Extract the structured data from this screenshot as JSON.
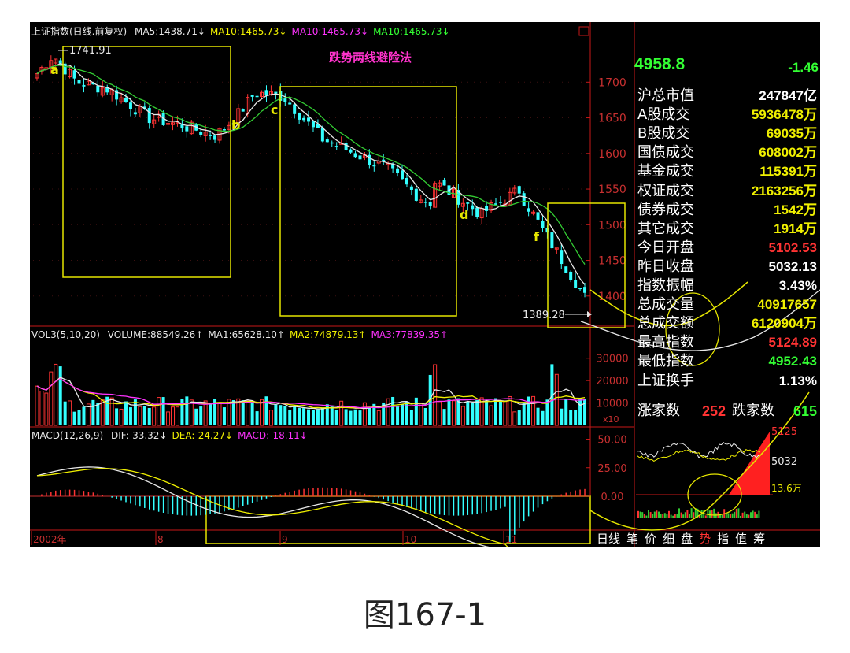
{
  "header": {
    "price_title": "上证指数(日线.前复权)",
    "price_mas": [
      {
        "text": "MA5:1438.71",
        "color": "#e8e8e8"
      },
      {
        "text": "MA10:1465.73",
        "color": "#f0f000"
      },
      {
        "text": "MA10:1465.73",
        "color": "#ff33ff"
      },
      {
        "text": "MA10:1465.73",
        "color": "#33ff33"
      }
    ],
    "vol_title": "VOL3(5,10,20)",
    "vol_items": [
      {
        "text": "VOLUME:88549.26",
        "color": "#e8e8e8"
      },
      {
        "text": "MA1:65628.10",
        "color": "#e8e8e8"
      },
      {
        "text": "MA2:74879.13",
        "color": "#f0f000"
      },
      {
        "text": "MA3:77839.35",
        "color": "#ff33ff"
      }
    ],
    "macd_title": "MACD(12,26,9)",
    "macd_items": [
      {
        "text": "DIF:-33.32",
        "color": "#e8e8e8"
      },
      {
        "text": "DEA:-24.27",
        "color": "#f0f000"
      },
      {
        "text": "MACD:-18.11",
        "color": "#ff33ff"
      }
    ]
  },
  "annotations": {
    "chart_title": "跌势两线避险法",
    "high_label": "1741.91",
    "low_label": "1389.28",
    "points": [
      "a",
      "b",
      "c",
      "d",
      "f"
    ]
  },
  "side": {
    "top_value": "4958.8",
    "top_value_right": "-1.46",
    "rows": [
      {
        "label": "沪总市值",
        "value": "247847亿",
        "color": "wht"
      },
      {
        "label": "A股成交",
        "value": "5936478万",
        "color": "yel"
      },
      {
        "label": "B股成交",
        "value": "69035万",
        "color": "yel"
      },
      {
        "label": "国债成交",
        "value": "608002万",
        "color": "yel"
      },
      {
        "label": "基金成交",
        "value": "115391万",
        "color": "yel"
      },
      {
        "label": "权证成交",
        "value": "2163256万",
        "color": "yel"
      },
      {
        "label": "债券成交",
        "value": "1542万",
        "color": "yel"
      },
      {
        "label": "其它成交",
        "value": "1914万",
        "color": "yel"
      },
      {
        "label": "今日开盘",
        "value": "5102.53",
        "color": "red"
      },
      {
        "label": "昨日收盘",
        "value": "5032.13",
        "color": "wht"
      },
      {
        "label": "指数振幅",
        "value": "3.43%",
        "color": "wht"
      },
      {
        "label": "总成交量",
        "value": "40917657",
        "color": "yel"
      },
      {
        "label": "总成交额",
        "value": "6120904万",
        "color": "yel"
      },
      {
        "label": "最高指数",
        "value": "5124.89",
        "color": "red"
      },
      {
        "label": "最低指数",
        "value": "4952.43",
        "color": "grn"
      },
      {
        "label": "上证换手",
        "value": "1.13%",
        "color": "wht"
      }
    ],
    "up_label": "涨家数",
    "up_value": "252",
    "down_label": "跌家数",
    "down_value": "615",
    "mini_high": "5125",
    "mini_mid": "5032",
    "mini_vol": "13.6万"
  },
  "tabs": [
    "日线",
    "笔",
    "价",
    "细",
    "盘",
    "势",
    "指",
    "值",
    "筹"
  ],
  "active_tab": "势",
  "caption": "图167-1",
  "chart_data": [
    {
      "type": "candlestick",
      "title": "上证指数(日线.前复权)",
      "ylim": [
        1360,
        1760
      ],
      "y_ticks": [
        1700,
        1650,
        1600,
        1550,
        1500,
        1450,
        1400
      ],
      "x_ticks": [
        "2002年",
        "8",
        "9",
        "10",
        "11"
      ],
      "series": [
        {
          "name": "MA5",
          "values": [
            1438.71
          ]
        },
        {
          "name": "MA10",
          "values": [
            1465.73
          ]
        }
      ],
      "annotations": [
        "1741.91",
        "1389.28"
      ]
    },
    {
      "type": "bar",
      "title": "VOL3(5,10,20)",
      "y_ticks": [
        30000,
        20000,
        10000
      ],
      "unit": "x10",
      "series": [
        {
          "name": "VOLUME",
          "values": [
            88549.26
          ]
        },
        {
          "name": "MA1",
          "values": [
            65628.1
          ]
        },
        {
          "name": "MA2",
          "values": [
            74879.13
          ]
        },
        {
          "name": "MA3",
          "values": [
            77839.35
          ]
        }
      ]
    },
    {
      "type": "bar",
      "title": "MACD(12,26,9)",
      "y_ticks": [
        50,
        25,
        0
      ],
      "series": [
        {
          "name": "DIF",
          "values": [
            -33.32
          ]
        },
        {
          "name": "DEA",
          "values": [
            -24.27
          ]
        },
        {
          "name": "MACD",
          "values": [
            -18.11
          ]
        }
      ]
    }
  ]
}
